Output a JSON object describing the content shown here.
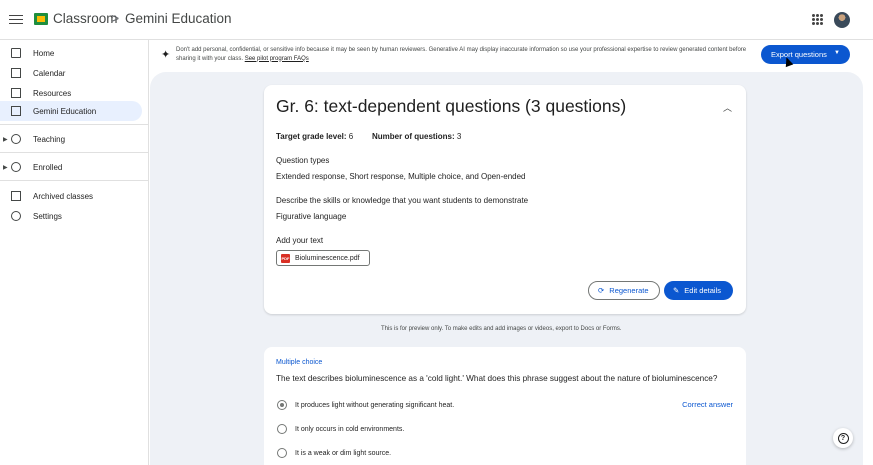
{
  "header": {
    "app_name": "Classroom",
    "separator": ">",
    "course_name": "Gemini Education"
  },
  "sidebar": {
    "items": [
      {
        "label": "Home",
        "icon": "home-icon"
      },
      {
        "label": "Calendar",
        "icon": "calendar-icon"
      },
      {
        "label": "Resources",
        "icon": "resources-icon"
      },
      {
        "label": "Gemini Education",
        "icon": "class-icon"
      },
      {
        "label": "Teaching",
        "icon": "teaching-icon"
      },
      {
        "label": "Enrolled",
        "icon": "enrolled-icon"
      },
      {
        "label": "Archived classes",
        "icon": "archive-icon"
      },
      {
        "label": "Settings",
        "icon": "settings-icon"
      }
    ]
  },
  "notice": {
    "text": "Don't add personal, confidential, or sensitive info because it may be seen by human reviewers. Generative AI may display inaccurate information so use your professional expertise to review generated content before sharing it with your class.",
    "link": "See pilot program FAQs"
  },
  "export_button": "Export questions",
  "card": {
    "title": "Gr. 6: text-dependent questions (3 questions)",
    "target_grade_label": "Target grade level:",
    "target_grade_value": "6",
    "num_questions_label": "Number of questions:",
    "num_questions_value": "3",
    "question_types_label": "Question types",
    "question_types_value": "Extended response, Short response, Multiple choice, and Open-ended",
    "skills_label": "Describe the skills or knowledge that you want students to demonstrate",
    "skills_value": "Figurative language",
    "text_label": "Add your text",
    "file_name": "Bioluminescence.pdf",
    "regenerate": "Regenerate",
    "edit_details": "Edit details"
  },
  "preview_note": "This is for preview only. To make edits and add images or videos, export to Docs or Forms.",
  "question": {
    "type": "Multiple choice",
    "text": "The text describes bioluminescence as a 'cold light.' What does this phrase suggest about the nature of bioluminescence?",
    "correct_label": "Correct answer",
    "options": [
      "It produces light without generating significant heat.",
      "It only occurs in cold environments.",
      "It is a weak or dim light source."
    ]
  },
  "colors": {
    "accent": "#0b57d0",
    "active_nav": "#e8f0fe",
    "main_background": "#eef1f6"
  }
}
